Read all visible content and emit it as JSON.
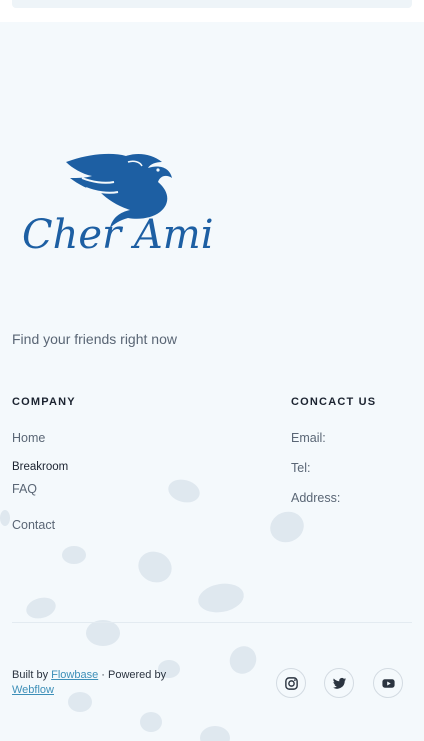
{
  "brand": {
    "name": "Cher Ami",
    "tagline": "Find your friends right now",
    "logo_color": "#1d5fa3"
  },
  "company": {
    "title": "COMPANY",
    "links": [
      "Home",
      "Breakroom",
      "FAQ",
      "Contact"
    ]
  },
  "contact": {
    "title": "CONCACT US",
    "email": "Email:",
    "tel": "Tel:",
    "address": "Address:"
  },
  "credits": {
    "built_by": "Built by",
    "flowbase": "Flowbase",
    "powered_by": "· Powered by",
    "webflow": "Webflow"
  },
  "social": {
    "icons": [
      "instagram-icon",
      "twitter-icon",
      "youtube-icon"
    ]
  },
  "colors": {
    "background": "#f4f9fc",
    "link_accent": "#3d8fb8",
    "text_dark": "#1b2330",
    "text_muted": "#5a6675"
  }
}
